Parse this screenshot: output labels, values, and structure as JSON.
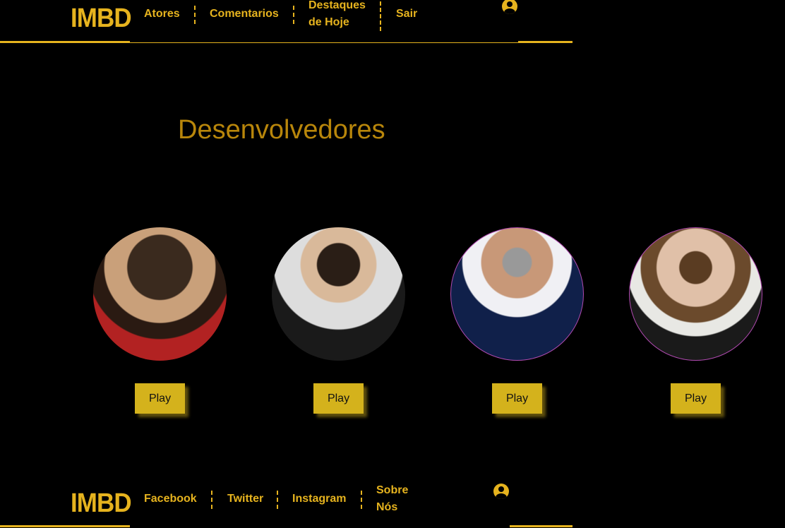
{
  "header": {
    "logo": "IMBD",
    "nav": [
      "Atores",
      "Comentarios",
      "Destaques de Hoje",
      "Sair"
    ],
    "nav_multiline": {
      "line1": "Destaques",
      "line2": "de Hoje"
    }
  },
  "main": {
    "title": "Desenvolvedores",
    "developers": [
      {
        "button": "Play"
      },
      {
        "button": "Play"
      },
      {
        "button": "Play"
      },
      {
        "button": "Play"
      }
    ]
  },
  "footer": {
    "logo": "IMBD",
    "links": [
      "Facebook",
      "Twitter",
      "Instagram"
    ],
    "sobre": {
      "line1": "Sobre",
      "line2": "Nós"
    }
  },
  "colors": {
    "accent": "#e6b31e",
    "title": "#b8860b",
    "button": "#d4b21c",
    "background": "#000000"
  },
  "icons": [
    "user-circle-icon"
  ]
}
